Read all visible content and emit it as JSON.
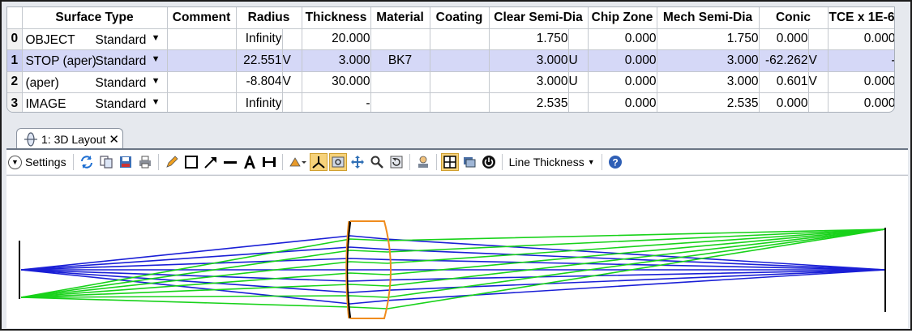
{
  "table": {
    "headers": {
      "surface_type": "Surface Type",
      "comment": "Comment",
      "radius": "Radius",
      "thickness": "Thickness",
      "material": "Material",
      "coating": "Coating",
      "clear_semi_dia": "Clear Semi-Dia",
      "chip_zone": "Chip Zone",
      "mech_semi_dia": "Mech Semi-Dia",
      "conic": "Conic",
      "tce": "TCE x 1E-6"
    },
    "rows": [
      {
        "num": "0",
        "tag": "OBJECT",
        "type": "Standard",
        "comment": "",
        "radius": "Infinity",
        "radius_flag": "",
        "thickness": "20.000",
        "thickness_flag": "",
        "material": "",
        "coating": "",
        "clear_semi_dia": "1.750",
        "clear_flag": "",
        "chip_zone": "0.000",
        "mech_semi_dia": "1.750",
        "conic": "0.000",
        "conic_flag": "",
        "tce": "0.000"
      },
      {
        "num": "1",
        "tag": "STOP (aper)",
        "type": "Standard",
        "comment": "",
        "radius": "22.551",
        "radius_flag": "V",
        "thickness": "3.000",
        "thickness_flag": "",
        "material": "BK7",
        "coating": "",
        "clear_semi_dia": "3.000",
        "clear_flag": "U",
        "chip_zone": "0.000",
        "mech_semi_dia": "3.000",
        "conic": "-62.262",
        "conic_flag": "V",
        "tce": "-"
      },
      {
        "num": "2",
        "tag": "(aper)",
        "type": "Standard",
        "comment": "",
        "radius": "-8.804",
        "radius_flag": "V",
        "thickness": "30.000",
        "thickness_flag": "",
        "material": "",
        "coating": "",
        "clear_semi_dia": "3.000",
        "clear_flag": "U",
        "chip_zone": "0.000",
        "mech_semi_dia": "3.000",
        "conic": "0.601",
        "conic_flag": "V",
        "tce": "0.000"
      },
      {
        "num": "3",
        "tag": "IMAGE",
        "type": "Standard",
        "comment": "",
        "radius": "Infinity",
        "radius_flag": "",
        "thickness": "-",
        "thickness_flag": "",
        "material": "",
        "coating": "",
        "clear_semi_dia": "2.535",
        "clear_flag": "",
        "chip_zone": "0.000",
        "mech_semi_dia": "2.535",
        "conic": "0.000",
        "conic_flag": "",
        "tce": "0.000"
      }
    ]
  },
  "tab": {
    "label": "1: 3D Layout",
    "icon": "lens-icon",
    "close": "✕"
  },
  "toolbar": {
    "settings_label": "Settings",
    "line_thickness_label": "Line Thickness",
    "icons": [
      "refresh-icon",
      "copy-icon",
      "save-icon",
      "print-icon",
      "pencil-icon",
      "rectangle-icon",
      "arrow-icon",
      "line-icon",
      "text-icon",
      "dimension-icon",
      "rotate-icon",
      "axes-icon",
      "zoom-window-icon",
      "pan-icon",
      "zoom-icon",
      "reset-view-icon",
      "export-icon",
      "grid-icon",
      "layers-icon",
      "power-icon",
      "help-icon"
    ]
  },
  "colors": {
    "selected_row": "#d5d8f7",
    "lens_outline": "#f08c1e",
    "ray_field_1": "#1a1fd6",
    "ray_field_2": "#18d21a"
  }
}
